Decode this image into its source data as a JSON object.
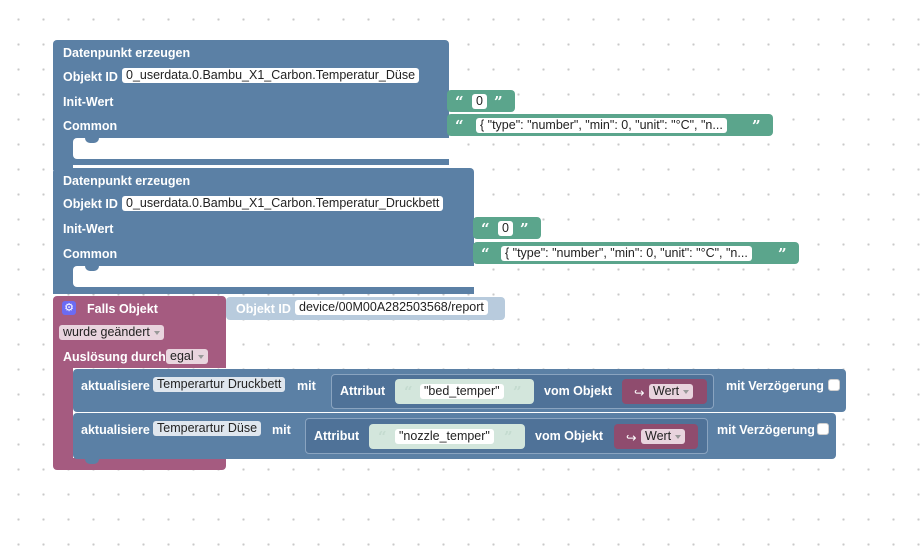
{
  "block1": {
    "title": "Datenpunkt erzeugen",
    "objekt_id_label": "Objekt ID",
    "objekt_id_value": "0_userdata.0.Bambu_X1_Carbon.Temperatur_Düse",
    "init_label": "Init-Wert",
    "init_value": "0",
    "common_label": "Common",
    "common_value": "{ \"type\": \"number\", \"min\": 0, \"unit\": \"°C\", \"n..."
  },
  "block2": {
    "title": "Datenpunkt erzeugen",
    "objekt_id_label": "Objekt ID",
    "objekt_id_value": "0_userdata.0.Bambu_X1_Carbon.Temperatur_Druckbett",
    "init_label": "Init-Wert",
    "init_value": "0",
    "common_label": "Common",
    "common_value": "{ \"type\": \"number\", \"min\": 0, \"unit\": \"°C\", \"n..."
  },
  "trigger": {
    "title": "Falls Objekt",
    "objekt_id_label": "Objekt ID",
    "objekt_id_value": "device/00M00A282503568/report",
    "changed_select": "wurde geändert",
    "trigger_label": "Auslösung durch",
    "trigger_select": "egal"
  },
  "update1": {
    "label": "aktualisiere",
    "target": "Temperartur Druckbett",
    "with_label": "mit",
    "attr_label": "Attribut",
    "attr_value": "\"bed_temper\"",
    "from_label": "vom Objekt",
    "obj_select": "Wert",
    "delay_label": "mit Verzögerung"
  },
  "update2": {
    "label": "aktualisiere",
    "target": "Temperartur Düse",
    "with_label": "mit",
    "attr_label": "Attribut",
    "attr_value": "\"nozzle_temper\"",
    "from_label": "vom Objekt",
    "obj_select": "Wert",
    "delay_label": "mit Verzögerung"
  },
  "glyphs": {
    "quote_open": "“",
    "quote_close": "”",
    "gear": "⚙",
    "arrow": "↪"
  },
  "colors": {
    "blue_block": "#5b80a5",
    "green_block": "#5ba58c",
    "pink_block": "#a55b80",
    "gear_badge": "#6b6bf2"
  }
}
